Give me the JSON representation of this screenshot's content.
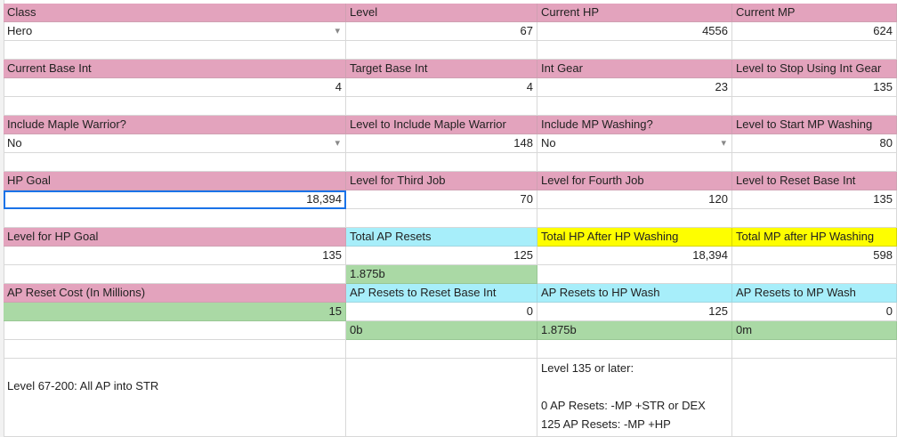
{
  "r0": {
    "class_h": "Class",
    "level_h": "Level",
    "curhp_h": "Current HP",
    "curmp_h": "Current MP"
  },
  "r1": {
    "class_v": "Hero",
    "level_v": "67",
    "curhp_v": "4556",
    "curmp_v": "624"
  },
  "r3": {
    "a": "Current Base Int",
    "b": "Target Base Int",
    "c": "Int Gear",
    "d": "Level to Stop Using Int Gear"
  },
  "r4": {
    "a": "4",
    "b": "4",
    "c": "23",
    "d": "135"
  },
  "r6": {
    "a": "Include Maple Warrior?",
    "b": "Level to Include Maple Warrior",
    "c": "Include MP Washing?",
    "d": "Level to Start MP Washing"
  },
  "r7": {
    "a": "No",
    "b": "148",
    "c": "No",
    "d": "80"
  },
  "r9": {
    "a": "HP Goal",
    "b": "Level for Third Job",
    "c": "Level for Fourth Job",
    "d": "Level to Reset Base Int"
  },
  "r10": {
    "a": "18,394",
    "b": "70",
    "c": "120",
    "d": "135"
  },
  "r12": {
    "a": "Level for HP Goal",
    "b": "Total AP Resets",
    "c": "Total HP After HP Washing",
    "d": "Total MP after HP Washing"
  },
  "r13": {
    "a": "135",
    "b": "125",
    "c": "18,394",
    "d": "598"
  },
  "r14": {
    "b": "1.875b"
  },
  "r15": {
    "a": "AP Reset Cost (In Millions)",
    "b": "AP Resets to Reset Base Int",
    "c": "AP Resets to HP Wash",
    "d": "AP Resets to MP Wash"
  },
  "r16": {
    "a": "15",
    "b": "0",
    "c": "125",
    "d": "0"
  },
  "r17": {
    "b": "0b",
    "c": "1.875b",
    "d": "0m"
  },
  "notes": {
    "level_range": "Level 67-200: All AP into STR",
    "later": "Level 135 or later:",
    "line1": "0 AP Resets: -MP +STR or DEX",
    "line2": "125 AP Resets: -MP +HP"
  },
  "colors": {
    "header_pink": "#e3a3bd",
    "cyan": "#a7eefa",
    "yellow": "#fefe00",
    "green": "#aad9a5",
    "selection": "#1a73e8"
  },
  "icons": {
    "dropdown": "dropdown-arrow-icon"
  }
}
